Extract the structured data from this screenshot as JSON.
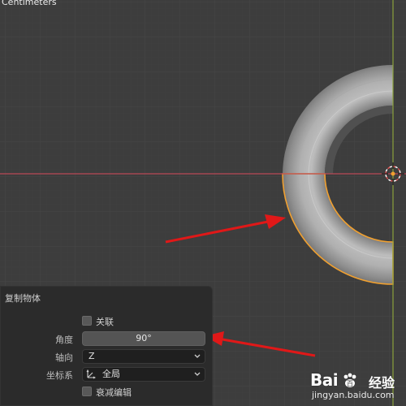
{
  "viewport": {
    "unit_label": "Centimeters",
    "colors": {
      "background": "#3d3d3d",
      "grid": "#454545",
      "x_axis": "#b84a56",
      "y_axis": "#8aa13c",
      "selection_outline": "#f0a030",
      "annotation_arrow": "#e01818"
    }
  },
  "panel": {
    "title": "复制物体",
    "linked": {
      "label": "关联",
      "checked": false
    },
    "angle": {
      "label": "角度",
      "value": "90°"
    },
    "axis": {
      "label": "轴向",
      "value": "Z"
    },
    "coord": {
      "label": "坐标系",
      "value": "全局"
    },
    "falloff": {
      "label": "衰减编辑",
      "checked": false
    }
  },
  "watermark": {
    "brand": "Bai",
    "brand_tail": "百",
    "cn": "经验",
    "url": "jingyan.baidu.com"
  }
}
